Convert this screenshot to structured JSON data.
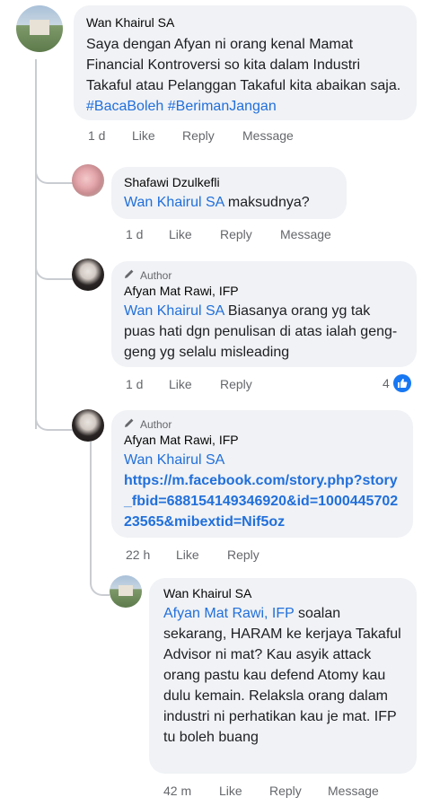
{
  "comments": [
    {
      "author": "Wan Khairul SA",
      "badge": "",
      "text_parts": [
        {
          "type": "text",
          "value": "Saya dengan Afyan ni orang kenal Mamat Financial Kontroversi so kita dalam Industri Takaful atau Pelanggan Takaful kita abaikan saja. "
        },
        {
          "type": "hashtag",
          "value": "#BacaBoleh"
        },
        {
          "type": "text",
          "value": " "
        },
        {
          "type": "hashtag",
          "value": "#BerimanJangan"
        }
      ],
      "time": "1 d",
      "like": "Like",
      "reply": "Reply",
      "message": "Message"
    },
    {
      "author": "Shafawi Dzulkefli",
      "badge": "",
      "text_parts": [
        {
          "type": "mention",
          "value": "Wan Khairul SA"
        },
        {
          "type": "text",
          "value": " maksudnya?"
        }
      ],
      "time": "1 d",
      "like": "Like",
      "reply": "Reply",
      "message": "Message"
    },
    {
      "author": "Afyan Mat Rawi, IFP",
      "badge": "Author",
      "text_parts": [
        {
          "type": "mention",
          "value": "Wan Khairul SA"
        },
        {
          "type": "text",
          "value": " Biasanya orang yg tak puas hati dgn penulisan di atas ialah geng-geng yg selalu misleading"
        }
      ],
      "time": "1 d",
      "like": "Like",
      "reply": "Reply",
      "reaction_count": "4"
    },
    {
      "author": "Afyan Mat Rawi, IFP",
      "badge": "Author",
      "mention": "Wan Khairul SA",
      "link": "https://m.facebook.com/story.php?story_fbid=688154149346920&id=100044570223565&mibextid=Nif5oz",
      "time": "22 h",
      "like": "Like",
      "reply": "Reply"
    },
    {
      "author": "Wan Khairul SA",
      "badge": "",
      "text_parts": [
        {
          "type": "mention",
          "value": "Afyan Mat Rawi, IFP"
        },
        {
          "type": "text",
          "value": " soalan sekarang, HARAM ke kerjaya Takaful Advisor ni mat? Kau asyik attack orang pastu kau defend Atomy kau dulu kemain. Relaksla orang dalam industri ni perhatikan kau je mat. IFP tu boleh buang"
        }
      ],
      "time": "42 m",
      "like": "Like",
      "reply": "Reply",
      "message": "Message"
    }
  ],
  "icons": {
    "author_badge": "pencil-icon",
    "like_reaction": "thumbs-up-icon"
  },
  "colors": {
    "link": "#216fdb",
    "bubble": "#f0f2f5",
    "meta": "#65676b",
    "reaction": "#1877f2"
  }
}
